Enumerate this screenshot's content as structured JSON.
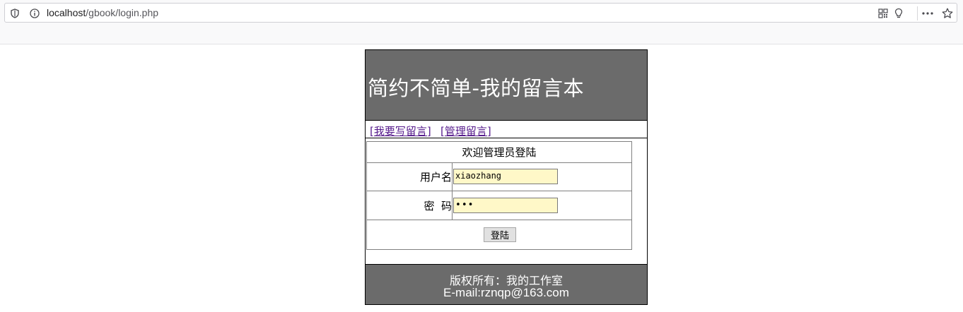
{
  "browser": {
    "url_host": "localhost",
    "url_path": "/gbook/login.php",
    "icons": [
      "shield-icon",
      "info-icon",
      "qr-code-icon",
      "lightbulb-icon",
      "more-icon",
      "star-icon"
    ]
  },
  "header": {
    "title": "简约不简单-我的留言本"
  },
  "nav": {
    "write_link": "[我要写留言]",
    "manage_link": "[管理留言]"
  },
  "login": {
    "welcome": "欢迎管理员登陆",
    "username_label": "用户名",
    "username_value": "xiaozhang",
    "password_label": "密  码",
    "password_value": "•••",
    "submit_label": "登陆"
  },
  "footer": {
    "copyright": "版权所有：我的工作室",
    "email": "E-mail:rznqp@163.com"
  },
  "colors": {
    "header_bg": "#6b6b6b",
    "link": "#551a8b",
    "input_bg": "#fff8c8"
  }
}
